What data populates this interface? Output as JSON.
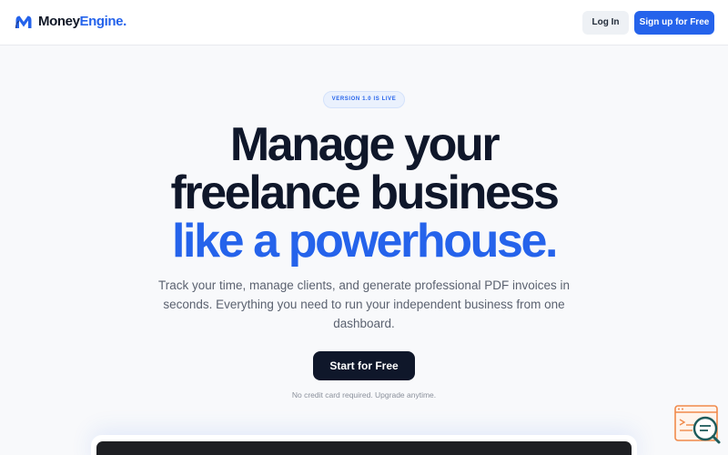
{
  "header": {
    "logo": {
      "part1": "Money",
      "part2": "Engine",
      "suffix": "."
    },
    "login_label": "Log In",
    "signup_label": "Sign up for Free"
  },
  "hero": {
    "badge": "VERSION 1.0 IS LIVE",
    "headline_line1": "Manage your",
    "headline_line2": "freelance business",
    "headline_line3": "like a powerhouse.",
    "subtitle": "Track your time, manage clients, and generate professional PDF invoices in seconds. Everything you need to run your independent business from one dashboard.",
    "cta_label": "Start for Free",
    "note": "No credit card required. Upgrade anytime."
  },
  "colors": {
    "brand_blue": "#2563eb",
    "dark": "#0f172a",
    "widget_orange": "#f08a4b",
    "widget_teal": "#1e5c5c"
  },
  "icons": {
    "logo": "m-logo-icon",
    "widget": "chat-search-icon"
  }
}
